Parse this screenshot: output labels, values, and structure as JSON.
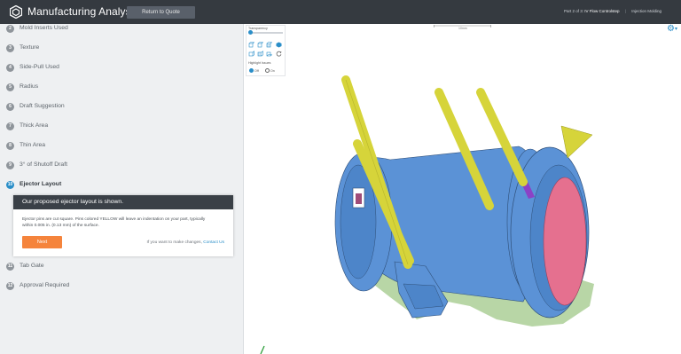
{
  "app": {
    "title": "Manufacturing Analysis",
    "return_button": "Return to Quote",
    "part_step": "Part 2 of 3:",
    "part_name": "IV Flow Controlstep",
    "process": "Injection Molding"
  },
  "steps": [
    {
      "num": "2",
      "label": "Mold Inserts Used"
    },
    {
      "num": "3",
      "label": "Texture"
    },
    {
      "num": "4",
      "label": "Side-Pull Used"
    },
    {
      "num": "5",
      "label": "Radius"
    },
    {
      "num": "6",
      "label": "Draft Suggestion"
    },
    {
      "num": "7",
      "label": "Thick Area"
    },
    {
      "num": "8",
      "label": "Thin Area"
    },
    {
      "num": "9",
      "label": "3° of Shutoff Draft"
    },
    {
      "num": "10",
      "label": "Ejector Layout"
    },
    {
      "num": "11",
      "label": "Tab Gate"
    },
    {
      "num": "12",
      "label": "Approval Required"
    }
  ],
  "active_step_index": 8,
  "panel": {
    "heading": "Our proposed ejector layout is shown.",
    "body": "Ejector pins are cut square. Pins colored YELLOW will leave an indentation on your part, typically within 0.005 in. (0.13 mm) of the surface.",
    "next_button": "Next",
    "help_text": "If you want to make changes,",
    "help_link": "Contact Us"
  },
  "viewer": {
    "transparency_label": "Transparency",
    "highlight_label": "Highlight Issues",
    "highlight_options": [
      "Off",
      "On"
    ],
    "highlight_selected": "Off",
    "scale_label": "10mm",
    "colors": {
      "part_blue": "#5b92d6",
      "pin_yellow": "#d6d43a",
      "cavity_pink": "#e5708f",
      "edge_green": "#b8d6a6",
      "accent": "#2a8ec8",
      "next_orange": "#f5843c"
    }
  },
  "icons": [
    "manufacturing-logo-icon",
    "settings-gear-icon",
    "view-cube-icon",
    "rotate-reset-icon"
  ]
}
